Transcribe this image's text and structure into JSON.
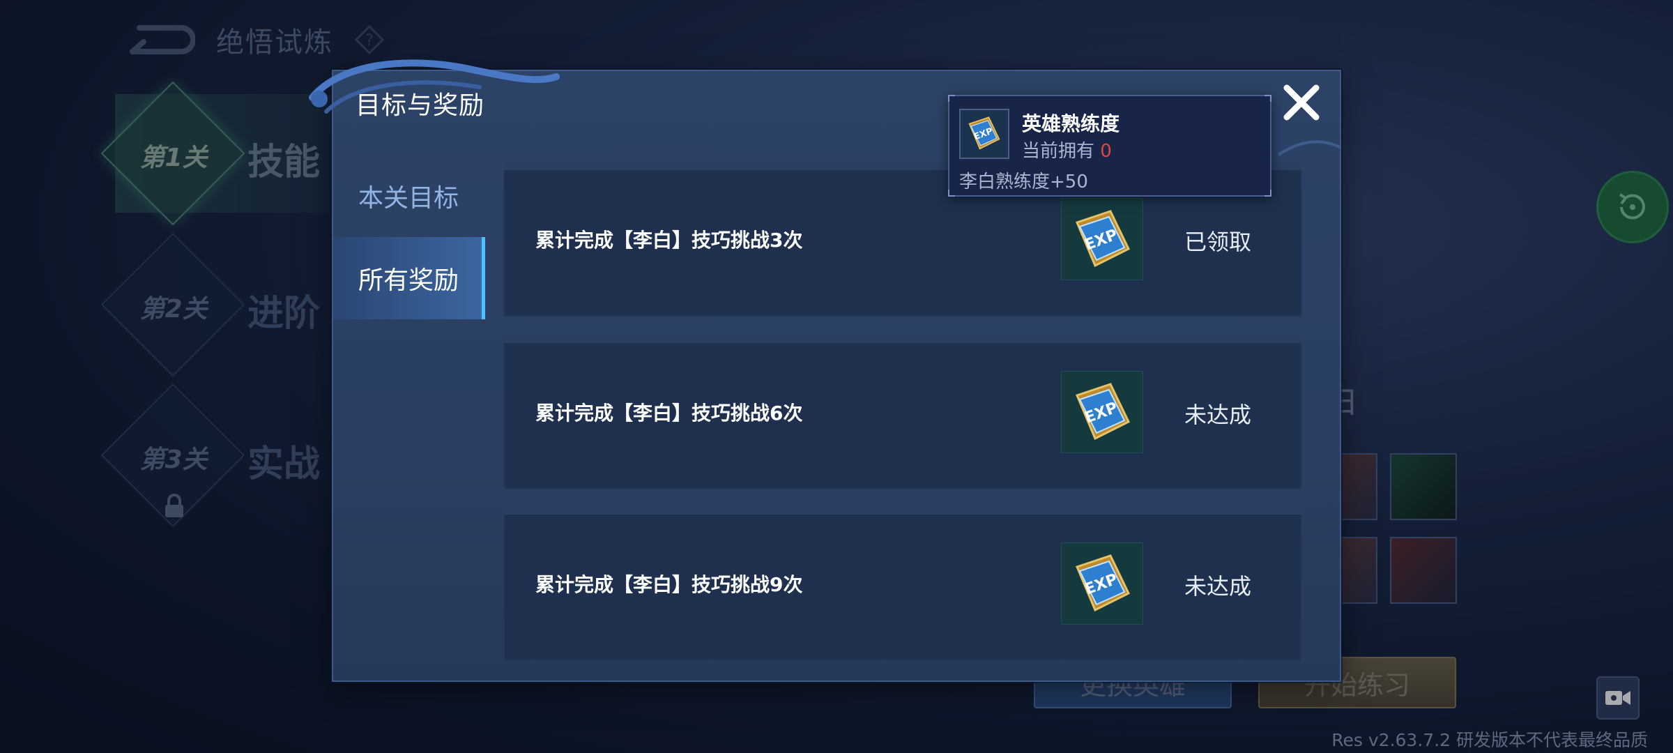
{
  "background": {
    "title": "绝悟试炼",
    "stages": [
      {
        "number": "第1关",
        "label": "技能"
      },
      {
        "number": "第2关",
        "label": "进阶"
      },
      {
        "number": "第3关",
        "label": "实战"
      }
    ],
    "hero_name_partial": "白",
    "buttons": {
      "change_hero": "更换英雄",
      "start_practice": "开始练习"
    },
    "version": "Res v2.63.7.2 研发版本不代表最终品质"
  },
  "modal": {
    "title": "目标与奖励",
    "tabs": [
      {
        "label": "本关目标",
        "active": false
      },
      {
        "label": "所有奖励",
        "active": true
      }
    ],
    "rewards": [
      {
        "goal": "累计完成【李白】技巧挑战3次",
        "reward_icon": "exp-book-icon",
        "status": "已领取"
      },
      {
        "goal": "累计完成【李白】技巧挑战6次",
        "reward_icon": "exp-book-icon",
        "status": "未达成"
      },
      {
        "goal": "累计完成【李白】技巧挑战9次",
        "reward_icon": "exp-book-icon",
        "status": "未达成"
      }
    ]
  },
  "tooltip": {
    "item_name": "英雄熟练度",
    "owned_label": "当前拥有",
    "owned_count": "0",
    "description": "李白熟练度+50"
  },
  "colors": {
    "accent_cyan": "#4fc1ff",
    "owned_count_red": "#e0473c",
    "modal_bg": "#2c4266"
  }
}
